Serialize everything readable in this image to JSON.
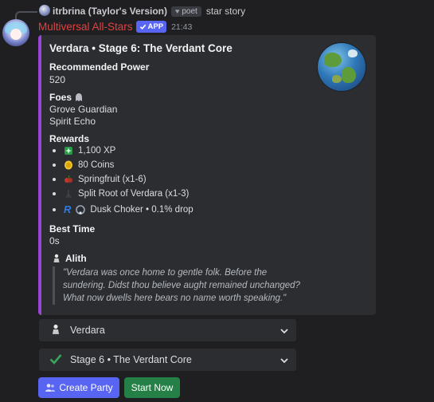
{
  "reply": {
    "author": "itrbrina (Taylor's Version)",
    "tag": "poet",
    "text": "star story"
  },
  "message": {
    "bot_name": "Multiversal All-Stars",
    "app_badge": "APP",
    "time": "21:43",
    "colors": {
      "bot_name": "#e0413f",
      "embed_accent": "#9b46d6",
      "app_badge": "#5865f2"
    }
  },
  "embed": {
    "title": "Verdara • Stage 6: The Verdant Core",
    "thumbnail_icon": "planet-globe-icon",
    "fields": {
      "power_name": "Recommended Power",
      "power_value": "520",
      "foes_name": "Foes",
      "foes": [
        "Grove Guardian",
        "Spirit Echo"
      ],
      "rewards_name": "Rewards",
      "rewards": [
        {
          "icon": "xp-sparkle-icon",
          "label": "1,100 XP"
        },
        {
          "icon": "coin-icon",
          "label": "80 Coins"
        },
        {
          "icon": "springfruit-icon",
          "label": "Springfruit (x1-6)"
        },
        {
          "icon": "split-root-icon",
          "label": "Split Root of Verdara (x1-3)"
        },
        {
          "rarity": "R",
          "icon": "dusk-choker-icon",
          "label": "Dusk Choker • 0.1% drop"
        }
      ],
      "best_time_name": "Best Time",
      "best_time_value": "0s"
    },
    "quote": {
      "speaker": "Alith",
      "text": "\"Verdara was once home to gentle folk. Before the sundering. Didst thou believe aught remained unchanged? What now dwells here bears no name worth speaking.\""
    }
  },
  "selects": [
    {
      "icon": "alith-figure-icon",
      "label": "Verdara"
    },
    {
      "icon": "checkmark-icon",
      "label": "Stage 6 • The Verdant Core"
    }
  ],
  "buttons": {
    "create_party": "Create Party",
    "start_now": "Start Now",
    "colors": {
      "create_party": "#5865f2",
      "start_now": "#248046"
    }
  }
}
